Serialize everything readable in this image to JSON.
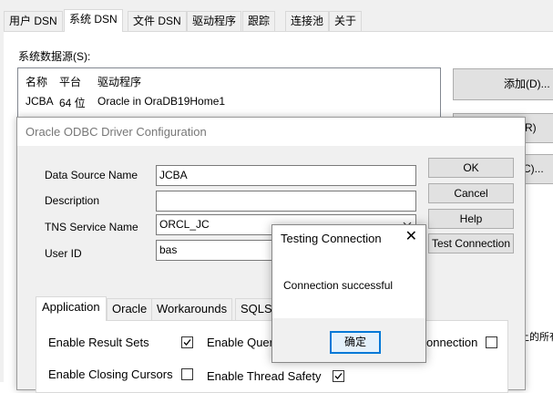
{
  "admin": {
    "tabs": [
      "用户 DSN",
      "系统 DSN",
      "文件 DSN",
      "驱动程序",
      "跟踪",
      "连接池",
      "关于"
    ],
    "active_tab": "系统 DSN",
    "system_dsn_label": "系统数据源(S):",
    "columns": [
      "名称",
      "平台",
      "驱动程序"
    ],
    "rows": [
      {
        "name": "JCBA",
        "platform": "64 位",
        "driver": "Oracle in OraDB19Home1"
      }
    ],
    "buttons": {
      "add": "添加(D)...",
      "remove_fragment": "除(R)",
      "configure_fragment": "置(C)..."
    },
    "truncated_text": "上的所有"
  },
  "config": {
    "title": "Oracle ODBC Driver Configuration",
    "labels": {
      "data_source_name": "Data Source Name",
      "description": "Description",
      "tns_service_name": "TNS Service Name",
      "user_id": "User ID"
    },
    "values": {
      "data_source_name": "JCBA",
      "description": "",
      "tns_service_name": "ORCL_JC",
      "user_id": "bas"
    },
    "buttons": {
      "ok": "OK",
      "cancel": "Cancel",
      "help": "Help",
      "test_connection": "Test Connection"
    },
    "tabs": [
      "Application",
      "Oracle",
      "Workarounds",
      "SQLSe"
    ],
    "active_tab": "Application",
    "options": {
      "enable_result_sets": {
        "label": "Enable Result Sets",
        "checked": true
      },
      "enable_query_fragment": {
        "label": "Enable Quer",
        "checked": false
      },
      "connection_fragment": {
        "label": "onnection",
        "checked": false
      },
      "enable_closing_cursors": {
        "label": "Enable Closing Cursors",
        "checked": false
      },
      "enable_thread_safety": {
        "label": "Enable Thread Safety",
        "checked": true
      }
    }
  },
  "message_box": {
    "title": "Testing Connection",
    "close_glyph": "✕",
    "text": "Connection successful",
    "ok_label": "确定"
  },
  "icons": {
    "dropdown": "chevron-down-icon",
    "check": "checkmark-icon",
    "close": "close-icon"
  }
}
